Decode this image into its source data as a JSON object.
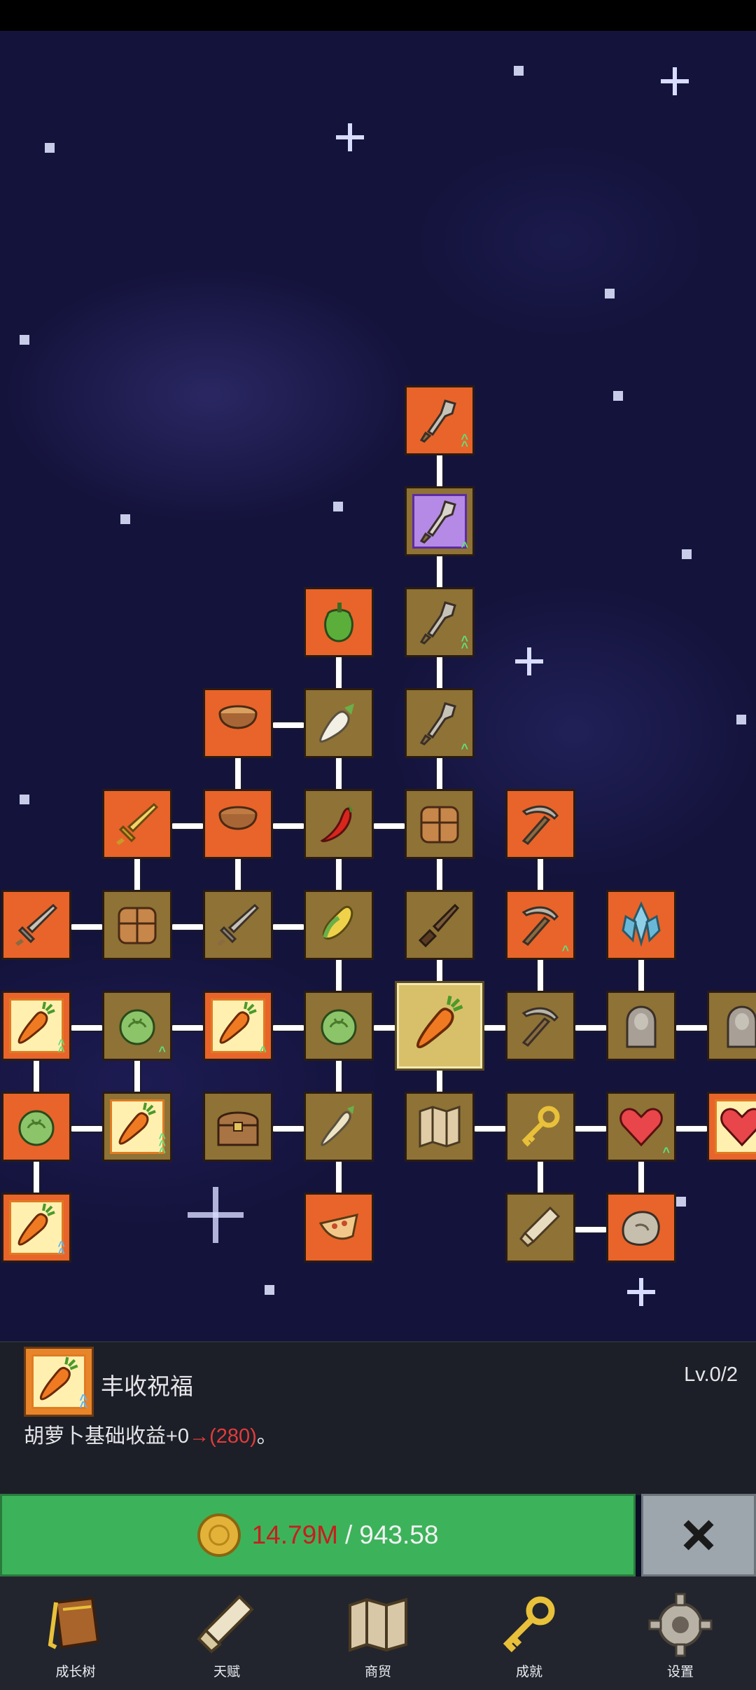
{
  "skill_tree": {
    "nodes": [
      {
        "id": "shovel-top",
        "icon": "shovel-icon",
        "style": "orange",
        "arrows": "green-2"
      },
      {
        "id": "shovel-purple",
        "icon": "shovel-icon",
        "style": "purple",
        "arrows": "green-1"
      },
      {
        "id": "bell-pepper",
        "icon": "bell-pepper-icon",
        "style": "orange"
      },
      {
        "id": "shovel-3",
        "icon": "shovel-icon",
        "style": "tan",
        "arrows": "green-2"
      },
      {
        "id": "wooden-bowl-1",
        "icon": "wooden-bowl-icon",
        "style": "orange"
      },
      {
        "id": "radish",
        "icon": "radish-icon",
        "style": "tan"
      },
      {
        "id": "shovel-4",
        "icon": "shovel-icon",
        "style": "tan",
        "arrows": "green-1"
      },
      {
        "id": "golden-sword",
        "icon": "golden-sword-icon",
        "style": "orange"
      },
      {
        "id": "wooden-bowl-2",
        "icon": "wooden-bowl-icon",
        "style": "orange"
      },
      {
        "id": "chili",
        "icon": "chili-pepper-icon",
        "style": "tan"
      },
      {
        "id": "crate-1",
        "icon": "crate-icon",
        "style": "tan"
      },
      {
        "id": "pickaxe-orange",
        "icon": "pickaxe-icon",
        "style": "orange"
      },
      {
        "id": "stone-sword-1",
        "icon": "stone-sword-icon",
        "style": "orange"
      },
      {
        "id": "crate-2",
        "icon": "crate-icon",
        "style": "tan"
      },
      {
        "id": "stone-sword-2",
        "icon": "stone-sword-icon",
        "style": "tan"
      },
      {
        "id": "corn",
        "icon": "corn-icon",
        "style": "tan"
      },
      {
        "id": "dagger",
        "icon": "dagger-icon",
        "style": "tan"
      },
      {
        "id": "pickaxe-2",
        "icon": "pickaxe-icon",
        "style": "orange",
        "arrows": "green-1"
      },
      {
        "id": "crystal",
        "icon": "crystal-icon",
        "style": "orange"
      },
      {
        "id": "carrot-1",
        "icon": "carrot-icon",
        "style": "orange",
        "arrows": "green-2",
        "framed": true
      },
      {
        "id": "cabbage-1",
        "icon": "cabbage-icon",
        "style": "tan",
        "arrows": "green-1"
      },
      {
        "id": "carrot-2",
        "icon": "carrot-icon",
        "style": "orange",
        "arrows": "green-1",
        "framed": true
      },
      {
        "id": "cabbage-2",
        "icon": "cabbage-icon",
        "style": "tan"
      },
      {
        "id": "carrot-selected",
        "icon": "carrot-icon",
        "style": "selected"
      },
      {
        "id": "pickaxe-3",
        "icon": "pickaxe-icon",
        "style": "tan"
      },
      {
        "id": "statue-1",
        "icon": "statue-icon",
        "style": "tan"
      },
      {
        "id": "statue-2",
        "icon": "statue-icon",
        "style": "tan"
      },
      {
        "id": "cabbage-3",
        "icon": "cabbage-icon",
        "style": "orange"
      },
      {
        "id": "carrot-3",
        "icon": "carrot-icon",
        "style": "tan",
        "arrows": "green-3",
        "framed": true
      },
      {
        "id": "treasure-chest",
        "icon": "treasure-chest-icon",
        "style": "tan"
      },
      {
        "id": "parsnip",
        "icon": "parsnip-icon",
        "style": "tan"
      },
      {
        "id": "map",
        "icon": "map-icon",
        "style": "tan"
      },
      {
        "id": "golden-key",
        "icon": "golden-key-icon",
        "style": "tan"
      },
      {
        "id": "heart-1",
        "icon": "heart-icon",
        "style": "tan",
        "arrows": "green-1"
      },
      {
        "id": "heart-2",
        "icon": "heart-icon",
        "style": "orange"
      },
      {
        "id": "carrot-4",
        "icon": "carrot-icon",
        "style": "orange",
        "arrows": "blue-2",
        "framed": true
      },
      {
        "id": "pizza",
        "icon": "pizza-slice-icon",
        "style": "orange"
      },
      {
        "id": "scroll",
        "icon": "scroll-icon",
        "style": "tan"
      },
      {
        "id": "stone",
        "icon": "stone-icon",
        "style": "orange"
      }
    ]
  },
  "info_panel": {
    "skill_name": "丰收祝福",
    "level": "Lv.0/2",
    "desc_prefix": "胡萝卜基础收益+0",
    "desc_highlight": "→(280)",
    "desc_suffix": "。",
    "icon": "carrot-icon"
  },
  "upgrade": {
    "cost_have": "14.79M",
    "separator": "/",
    "cost_need": "943.58",
    "coin_icon": "gold-coin-icon",
    "close_icon": "close-x-icon"
  },
  "bottom_nav": {
    "items": [
      {
        "label": "成长树",
        "icon": "book-icon"
      },
      {
        "label": "天赋",
        "icon": "scroll-icon"
      },
      {
        "label": "商贸",
        "icon": "map-icon"
      },
      {
        "label": "成就",
        "icon": "golden-key-icon"
      },
      {
        "label": "设置",
        "icon": "gear-icon"
      }
    ]
  },
  "colors": {
    "orange_tile": "#e8642a",
    "tan_tile": "#8e7236",
    "upgrade_green": "#3cb35a",
    "cost_red": "#c81d1d"
  }
}
